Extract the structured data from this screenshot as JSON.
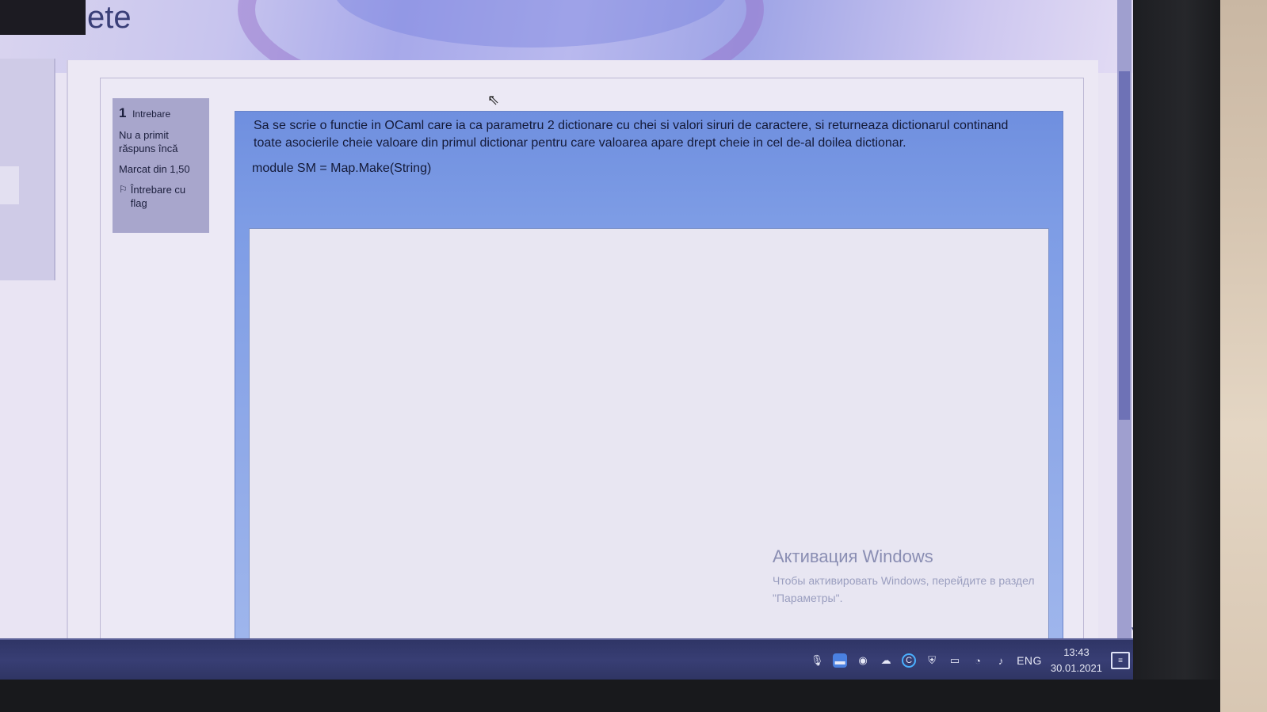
{
  "page": {
    "title_fragment": "ete"
  },
  "question_info": {
    "number": "1",
    "label": "Intrebare",
    "status": "Nu a primit răspuns încă",
    "marks": "Marcat din 1,50",
    "flag_label": "Întrebare cu flag"
  },
  "question": {
    "text": "Sa se scrie o functie in OCaml care ia ca parametru 2 dictionare cu chei si valori siruri de caractere, si returneaza dictionarul continand toate asocierile cheie valoare din primul dictionar pentru care valoarea apare drept cheie in cel de-al doilea dictionar.",
    "code_line": "module SM = Map.Make(String)",
    "answer_value": ""
  },
  "watermark": {
    "title": "Активация Windows",
    "line1": "Чтобы активировать Windows, перейдите в раздел",
    "line2": "\"Параметры\"."
  },
  "taskbar": {
    "icons": [
      "microphone-icon",
      "chat-icon",
      "globe-icon",
      "network-app-icon",
      "c-app-icon",
      "shield-icon",
      "battery-icon",
      "wifi-icon",
      "volume-icon"
    ],
    "language": "ENG",
    "time": "13:43",
    "date": "30.01.2021"
  },
  "colors": {
    "question_box": "#7d9ce5",
    "info_box": "#a8a6cc",
    "taskbar": "#383e74"
  }
}
